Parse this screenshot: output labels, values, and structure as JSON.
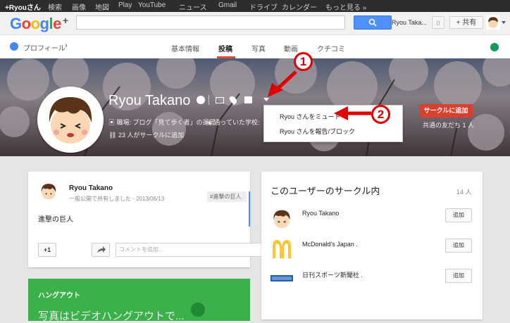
{
  "gbar": {
    "items": [
      "+Ryouさん",
      "検索",
      "画像",
      "地図",
      "Play",
      "YouTube",
      "ニュース",
      "Gmail",
      "ドライブ",
      "カレンダー",
      "もっと見る »"
    ]
  },
  "header": {
    "logo_text": "Google",
    "logo_plus": "+",
    "search_value": "",
    "user_name": "Ryou Taka...",
    "notification_count": "0",
    "share_label": "+ 共有"
  },
  "nav": {
    "profile_label": "プロフィール",
    "tabs": [
      "基本情報",
      "投稿",
      "写真",
      "動画",
      "クチコミ"
    ],
    "active_tab": "投稿"
  },
  "cover": {
    "name": "Ryou Takano",
    "job": "職場: ブログ「見て歩く者」の運営",
    "school": "通っていた学校:",
    "circles_text": "23 人がサークルに追加",
    "add_to_circle": "サークルに追加",
    "mutual": "共通の友だち 1 人"
  },
  "dropdown": {
    "items": [
      "Ryou さんをミュート",
      "Ryou さんを報告/ブロック"
    ]
  },
  "annotations": [
    "1",
    "2"
  ],
  "post": {
    "author": "Ryou Takano",
    "meta": "一般公開で共有しました - 2013/06/13",
    "tag": "#進撃の巨人",
    "body": "進撃の巨人",
    "plus_one": "+1",
    "comment_placeholder": "コメントを追加..."
  },
  "hangout": {
    "title": "ハングアウト",
    "text": "写真はビデオハングアウトで..."
  },
  "circle_panel": {
    "heading": "このユーザーのサークル内",
    "count": "14 人",
    "members": [
      {
        "name": "Ryou Takano",
        "add_label": "追加"
      },
      {
        "name": "McDonald's Japan .",
        "add_label": "追加"
      },
      {
        "name": "日刊スポーツ新聞社 .",
        "add_label": "追加"
      }
    ]
  },
  "colors": {
    "accent_red": "#dd4b39",
    "annotation_red": "#e00000",
    "search_blue": "#4d90fe",
    "hangout_green": "#3cb04a"
  }
}
